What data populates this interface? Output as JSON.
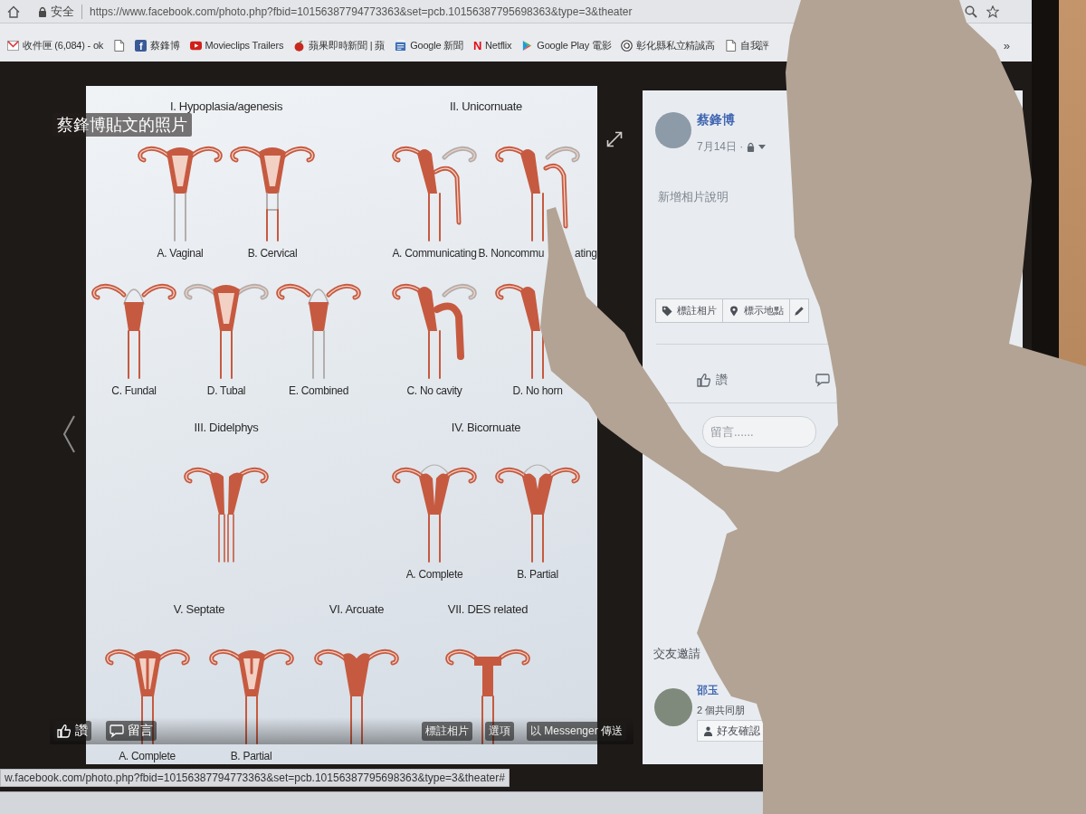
{
  "address_bar": {
    "security_label": "安全",
    "url": "https://www.facebook.com/photo.php?fbid=10156387794773363&set=pcb.10156387795698363&type=3&theater"
  },
  "bookmarks": [
    {
      "kind": "mail",
      "label": "收件匣 (6,084) - ok"
    },
    {
      "kind": "page"
    },
    {
      "kind": "tile",
      "logo_text": "f",
      "label": "蔡鋒博"
    },
    {
      "kind": "video",
      "label": "Movieclips Trailers"
    },
    {
      "kind": "apple",
      "label": "蘋果即時新聞 | 蘋"
    },
    {
      "kind": "news",
      "label": "Google 新聞"
    },
    {
      "kind": "mark",
      "logo_text": "N",
      "label": "Netflix"
    },
    {
      "kind": "play",
      "label": "Google Play 電影"
    },
    {
      "kind": "emblem",
      "label": "彰化縣私立精誠高"
    },
    {
      "kind": "page",
      "label": "自我評"
    }
  ],
  "bookmarks_overflow": "»",
  "stage": {
    "album_title": "蔡鋒博貼文的照片",
    "controls_left": [
      {
        "kind": "like",
        "label": "讚"
      },
      {
        "kind": "comment",
        "label": "留言"
      }
    ],
    "controls_right": [
      {
        "label": "標註相片"
      },
      {
        "label": "選項"
      },
      {
        "label": "以 Messenger 傳送"
      }
    ]
  },
  "diagram": {
    "bands": [
      {
        "sections": [
          {
            "title": "I. Hypoplasia/agenesis",
            "figure_rows": [
              [
                {
                  "kind": "vaginal",
                  "label": "A. Vaginal"
                },
                {
                  "kind": "cervical",
                  "label": "B. Cervical"
                }
              ],
              [
                {
                  "kind": "fundal",
                  "label": "C. Fundal"
                },
                {
                  "kind": "tubal",
                  "label": "D. Tubal"
                },
                {
                  "kind": "combined",
                  "label": "E. Combined"
                }
              ]
            ]
          },
          {
            "title": "II. Unicornuate",
            "figure_rows": [
              [
                {
                  "kind": "communicating",
                  "label": "A. Communicating"
                },
                {
                  "kind": "noncommunicating",
                  "label": "B. Noncommu",
                  "label_after_cover": "ating"
                }
              ],
              [
                {
                  "kind": "no-cavity",
                  "label": "C. No cavity"
                },
                {
                  "kind": "no-horn",
                  "label": "D. No horn"
                }
              ]
            ]
          }
        ]
      },
      {
        "sections": [
          {
            "title": "III. Didelphys",
            "figure_rows": [
              [
                {
                  "kind": "didelphys"
                }
              ]
            ]
          },
          {
            "title": "IV. Bicornuate",
            "figure_rows": [
              [
                {
                  "kind": "bicornuate-complete",
                  "label": "A. Complete"
                },
                {
                  "kind": "bicornuate-partial",
                  "label": "B. Partial"
                }
              ]
            ]
          }
        ]
      },
      {
        "sections": [
          {
            "title": "V. Septate",
            "figure_rows": [
              [
                {
                  "kind": "septate-complete",
                  "label": "A. Complete"
                },
                {
                  "kind": "septate-partial",
                  "label": "B. Partial"
                }
              ]
            ]
          },
          {
            "title": "VI. Arcuate",
            "figure_rows": [
              [
                {
                  "kind": "arcuate"
                }
              ]
            ]
          },
          {
            "title": "VII. DES related",
            "figure_rows": [
              [
                {
                  "kind": "t-shaped"
                }
              ]
            ]
          }
        ]
      }
    ]
  },
  "panel": {
    "author": {
      "name": "蔡鋒博",
      "date": "7月14日 ·"
    },
    "caption_prompt": "新增相片說明",
    "actions": [
      {
        "kind": "tag",
        "label": "標註相片"
      },
      {
        "kind": "location",
        "label": "標示地點"
      },
      {
        "kind": "edit"
      }
    ],
    "reactions": [
      {
        "kind": "like",
        "label": "讚"
      },
      {
        "kind": "comment"
      }
    ],
    "comment_field": {
      "placeholder": "留言......"
    },
    "friend_requests": {
      "title": "交友邀請",
      "items": [
        {
          "name": "邵玉",
          "mutual_friends": "2 個共同朋",
          "button": "好友確認"
        }
      ]
    }
  },
  "status_url": "w.facebook.com/photo.php?fbid=10156387794773363&set=pcb.10156387795698363&type=3&theater#"
}
